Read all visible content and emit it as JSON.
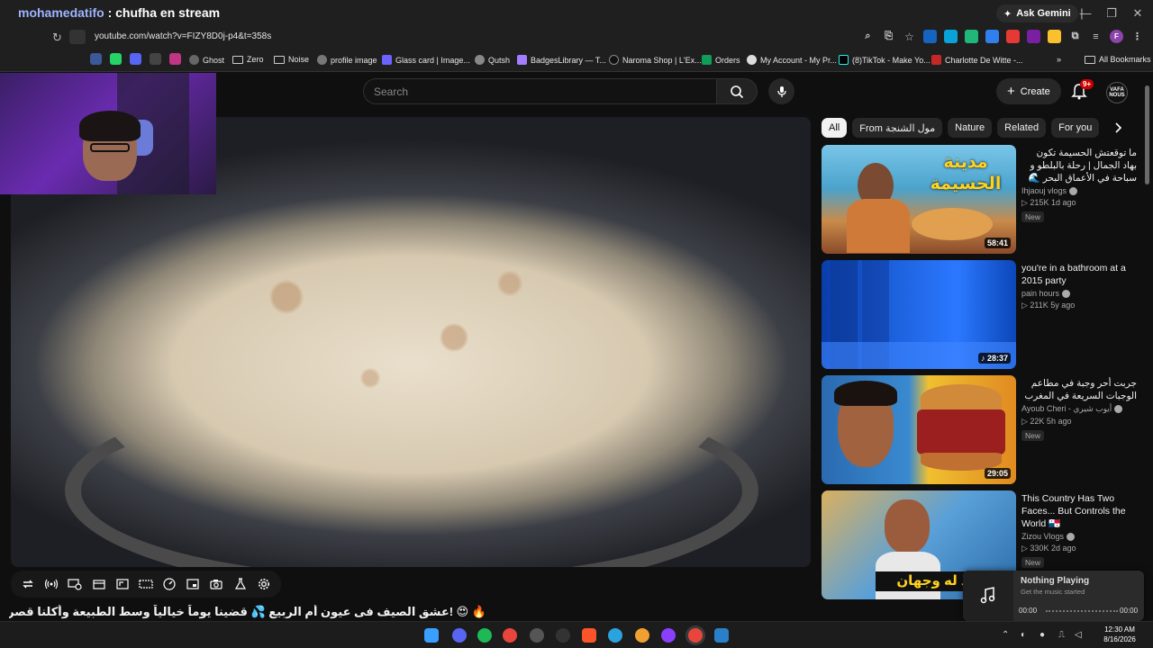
{
  "window": {
    "stream_user": "mohamedatifo",
    "stream_title": ": chufha en stream",
    "ask_gemini": "Ask Gemini",
    "controls": [
      "—",
      "❐",
      "✕"
    ]
  },
  "address": {
    "url": "youtube.com/watch?v=FIZY8D0j-p4&t=358s"
  },
  "bookmarks": {
    "items": [
      "Ghost",
      "Zero",
      "Noise",
      "profile image",
      "Glass card | Image...",
      "Qutsh",
      "BadgesLibrary — T...",
      "Naroma Shop | L'Ex...",
      "Orders",
      "My Account - My Pr...",
      "(8)TikTok - Make Yo...",
      "Charlotte De Witte -..."
    ],
    "more": "»",
    "all": "All Bookmarks"
  },
  "youtube": {
    "search_placeholder": "Search",
    "create_label": "Create",
    "notif_count": "9+",
    "avatar_text": "VAFA NOUS",
    "video_title": "🔥 😍 !عشق الصيف فى عيون أم الربيع 💦 قضينا يوماً خيالياً وسط الطبيعة وأكلنا قصرية رفيسة لذيذة 🌿",
    "chips": [
      "All",
      "From مول الشنجة",
      "Nature",
      "Related",
      "For you"
    ],
    "recommendations": [
      {
        "title": "ما توقعتش الحسيمة تكون بهاد الجمال | رحلة بالبلطو و سباحة في الأعماق البحر 🌊 تجربة ماكولات البحرية",
        "channel": "Ihjaouj vlogs",
        "meta": "▷ 215K  1d ago",
        "badge": "New",
        "duration": "58:41",
        "thumb_text": "مدينة الحسيمة"
      },
      {
        "title": "you're in a bathroom at a 2015 party",
        "channel": "pain hours",
        "meta": "▷ 211K  5y ago",
        "badge": "",
        "duration": "♪ 28:37",
        "thumb_text": ""
      },
      {
        "title": "جربت أحر وجبة في مطاعم الوجبات السريعة في المغرب",
        "channel": "Ayoub Cheri - أيوب شيري",
        "meta": "▷ 22K  5h ago",
        "badge": "New",
        "duration": "29:05",
        "thumb_text": ""
      },
      {
        "title": "This Country Has Two Faces... But Controls the World 🇵🇦",
        "channel": "Zizou Vlogs",
        "meta": "▷ 330K  2d ago",
        "badge": "New",
        "duration": "",
        "thumb_text": "البلد له وجهان"
      }
    ]
  },
  "music": {
    "title": "Nothing Playing",
    "subtitle": "Get the music started",
    "time_start": "00:00",
    "time_end": "00:00"
  },
  "taskbar": {
    "time": "12:30 AM",
    "date": "8/16/2026"
  },
  "colors": {
    "accent": "#3ea6ff",
    "notif_red": "#cc0000",
    "page_bg": "#0f0f0f"
  }
}
